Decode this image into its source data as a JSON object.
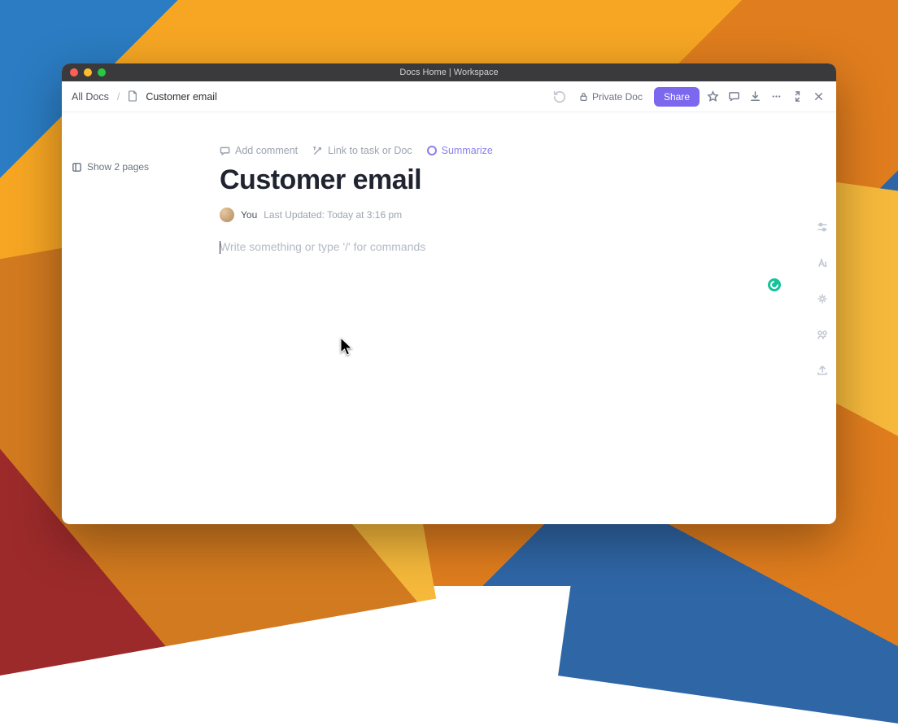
{
  "window": {
    "title": "Docs Home | Workspace"
  },
  "breadcrumb": {
    "root": "All Docs",
    "current": "Customer email"
  },
  "toolbar": {
    "private_label": "Private Doc",
    "share_label": "Share"
  },
  "sidebar": {
    "show_pages_label": "Show 2 pages"
  },
  "actions": {
    "add_comment": "Add comment",
    "link_task": "Link to task or Doc",
    "summarize": "Summarize"
  },
  "doc": {
    "title": "Customer email",
    "author": "You",
    "last_updated": "Last Updated: Today at 3:16 pm",
    "placeholder": "Write something or type '/' for commands"
  },
  "colors": {
    "accent": "#7b68ee"
  }
}
